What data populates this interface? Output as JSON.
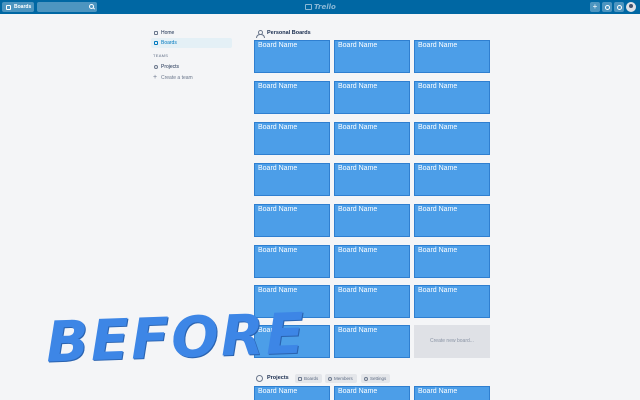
{
  "header": {
    "boards_label": "Boards",
    "search_placeholder": "",
    "logo_text": "Trello",
    "add_symbol": "+"
  },
  "sidebar": {
    "items": [
      {
        "label": "Home",
        "icon": "home-icon"
      },
      {
        "label": "Boards",
        "icon": "board-icon",
        "active": true
      }
    ],
    "teams_heading": "TEAMS",
    "teams": [
      {
        "label": "Projects",
        "icon": "team-icon"
      }
    ],
    "create_team_label": "Create a team"
  },
  "personal": {
    "title": "Personal Boards",
    "boards": [
      "Board Name",
      "Board Name",
      "Board Name",
      "Board Name",
      "Board Name",
      "Board Name",
      "Board Name",
      "Board Name",
      "Board Name",
      "Board Name",
      "Board Name",
      "Board Name",
      "Board Name",
      "Board Name",
      "Board Name",
      "Board Name",
      "Board Name",
      "Board Name",
      "Board Name",
      "Board Name",
      "Board Name",
      "Board Name",
      "Board Name"
    ],
    "create_label": "Create new board..."
  },
  "projects": {
    "title": "Projects",
    "tabs": [
      {
        "label": "Boards",
        "icon": "board-icon"
      },
      {
        "label": "Members",
        "icon": "members-icon"
      },
      {
        "label": "Settings",
        "icon": "gear-icon"
      }
    ],
    "boards": [
      "Board Name",
      "Board Name",
      "Board Name"
    ]
  },
  "overlay": {
    "text": "BEFORE"
  },
  "colors": {
    "header": "#0067a3",
    "board_tile": "#4c9ee8",
    "overlay_text": "#3d86e6",
    "background": "#f4f5f7"
  }
}
